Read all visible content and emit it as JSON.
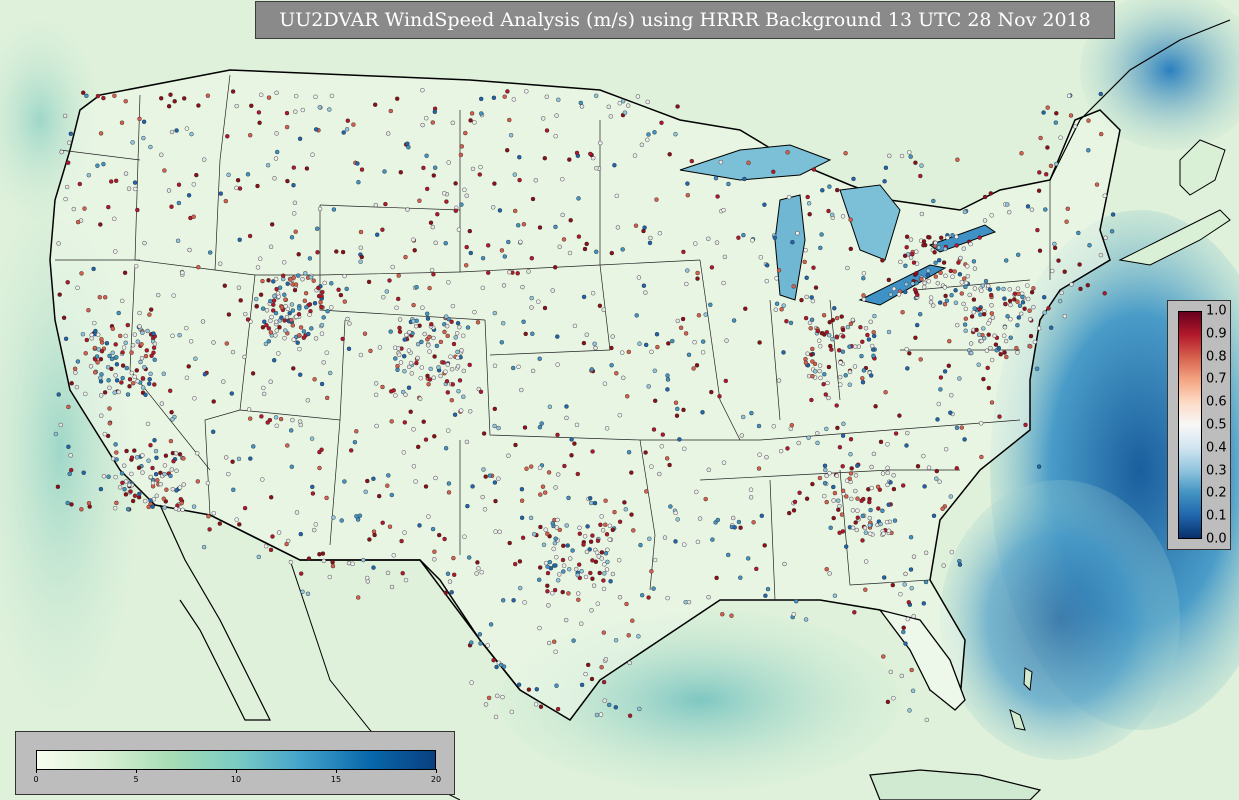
{
  "title": "UU2DVAR WindSpeed Analysis (m/s) using HRRR Background 13 UTC 28 Nov 2018",
  "map": {
    "region": "CONUS",
    "background_field": "WindSpeed",
    "units": "m/s",
    "base_color": "#e8f5e4",
    "land_color": "#eef8ea",
    "ocean_dark_color": "#1f6fb0"
  },
  "windspeed_colorbar": {
    "ticks": [
      "0",
      "5",
      "10",
      "15",
      "20"
    ],
    "range": [
      0,
      20
    ],
    "colors": [
      "#f7fcf0",
      "#d8f0d3",
      "#a8ddb5",
      "#7bccc4",
      "#43a2ca",
      "#0868ac",
      "#084081"
    ]
  },
  "observation_colorbar": {
    "ticks": [
      "1.0",
      "0.9",
      "0.8",
      "0.7",
      "0.6",
      "0.5",
      "0.4",
      "0.3",
      "0.2",
      "0.1",
      "0.0"
    ],
    "range": [
      0.0,
      1.0
    ],
    "colors": [
      "#08306b",
      "#2166ac",
      "#4393c3",
      "#92c5de",
      "#d1e5f0",
      "#f7f7f7",
      "#fddbc7",
      "#f4a582",
      "#d6604d",
      "#b2182b",
      "#67001f"
    ]
  },
  "observation_markers": {
    "colors_low": [
      "#2166ac",
      "#4393c3",
      "#92c5de"
    ],
    "colors_mid": [
      "#f0f0f0",
      "#e6e6e6"
    ],
    "colors_high": [
      "#d6604d",
      "#b2182b",
      "#8c1018"
    ]
  }
}
